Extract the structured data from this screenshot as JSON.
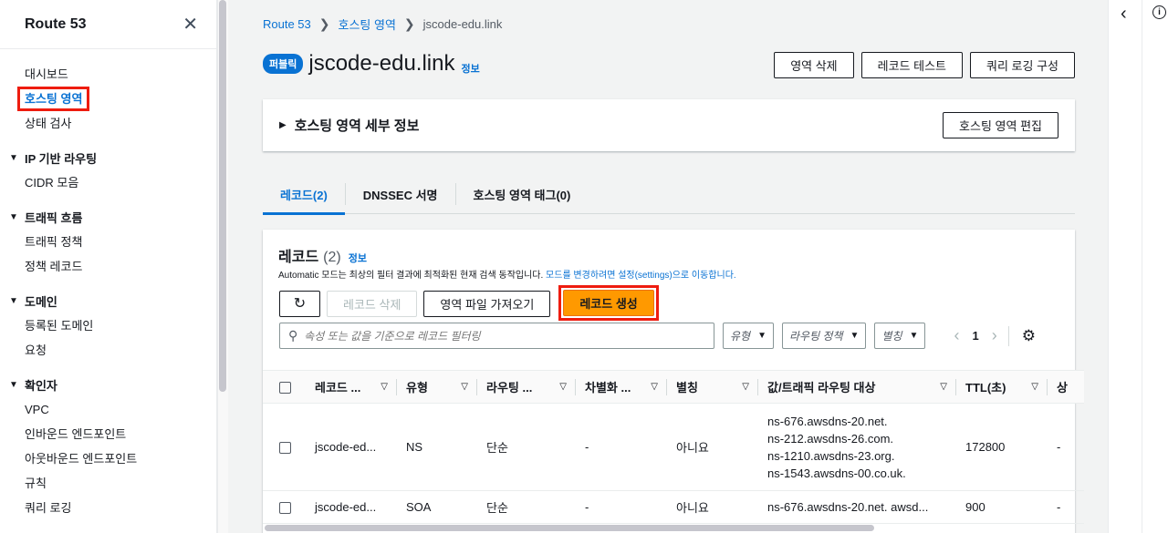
{
  "sidebar": {
    "title": "Route 53",
    "items": [
      {
        "label": "대시보드"
      },
      {
        "label": "호스팅 영역"
      },
      {
        "label": "상태 검사"
      }
    ],
    "sections": [
      {
        "label": "IP 기반 라우팅",
        "items": [
          "CIDR 모음"
        ]
      },
      {
        "label": "트래픽 흐름",
        "items": [
          "트래픽 정책",
          "정책 레코드"
        ]
      },
      {
        "label": "도메인",
        "items": [
          "등록된 도메인",
          "요청"
        ]
      },
      {
        "label": "확인자",
        "items": [
          "VPC",
          "인바운드 엔드포인트",
          "아웃바운드 엔드포인트",
          "규칙",
          "쿼리 로깅"
        ]
      }
    ]
  },
  "breadcrumb": {
    "root": "Route 53",
    "middle": "호스팅 영역",
    "current": "jscode-edu.link"
  },
  "header": {
    "badge": "퍼블릭",
    "title": "jscode-edu.link",
    "info": "정보",
    "actions": [
      "영역 삭제",
      "레코드 테스트",
      "쿼리 로깅 구성"
    ]
  },
  "details": {
    "label": "호스팅 영역 세부 정보",
    "edit": "호스팅 영역 편집"
  },
  "tabs": [
    "레코드(2)",
    "DNSSEC 서명",
    "호스팅 영역 태그(0)"
  ],
  "records": {
    "title": "레코드",
    "count": "(2)",
    "info": "정보",
    "desc_prefix": "Automatic 모드는 최상의 필터 결과에 최적화된 현재 검색 동작입니다. ",
    "desc_link": "모드를 변경하려면 설정(settings)으로 이동합니다.",
    "btn_delete": "레코드 삭제",
    "btn_import": "영역 파일 가져오기",
    "btn_create": "레코드 생성",
    "search_placeholder": "속성 또는 값을 기준으로 레코드 필터링",
    "filters": [
      "유형",
      "라우팅 정책",
      "별칭"
    ],
    "page": "1",
    "columns": [
      "레코드 ...",
      "유형",
      "라우팅 ...",
      "차별화 ...",
      "별칭",
      "값/트래픽 라우팅 대상",
      "TTL(초)",
      "상"
    ],
    "rows": [
      {
        "name": "jscode-ed...",
        "type": "NS",
        "routing": "단순",
        "diff": "-",
        "alias": "아니요",
        "values": [
          "ns-676.awsdns-20.net.",
          "ns-212.awsdns-26.com.",
          "ns-1210.awsdns-23.org.",
          "ns-1543.awsdns-00.co.uk."
        ],
        "ttl": "172800",
        "extra": "-"
      },
      {
        "name": "jscode-ed...",
        "type": "SOA",
        "routing": "단순",
        "diff": "-",
        "alias": "아니요",
        "values": [
          "ns-676.awsdns-20.net. awsd..."
        ],
        "ttl": "900",
        "extra": "-"
      }
    ]
  }
}
